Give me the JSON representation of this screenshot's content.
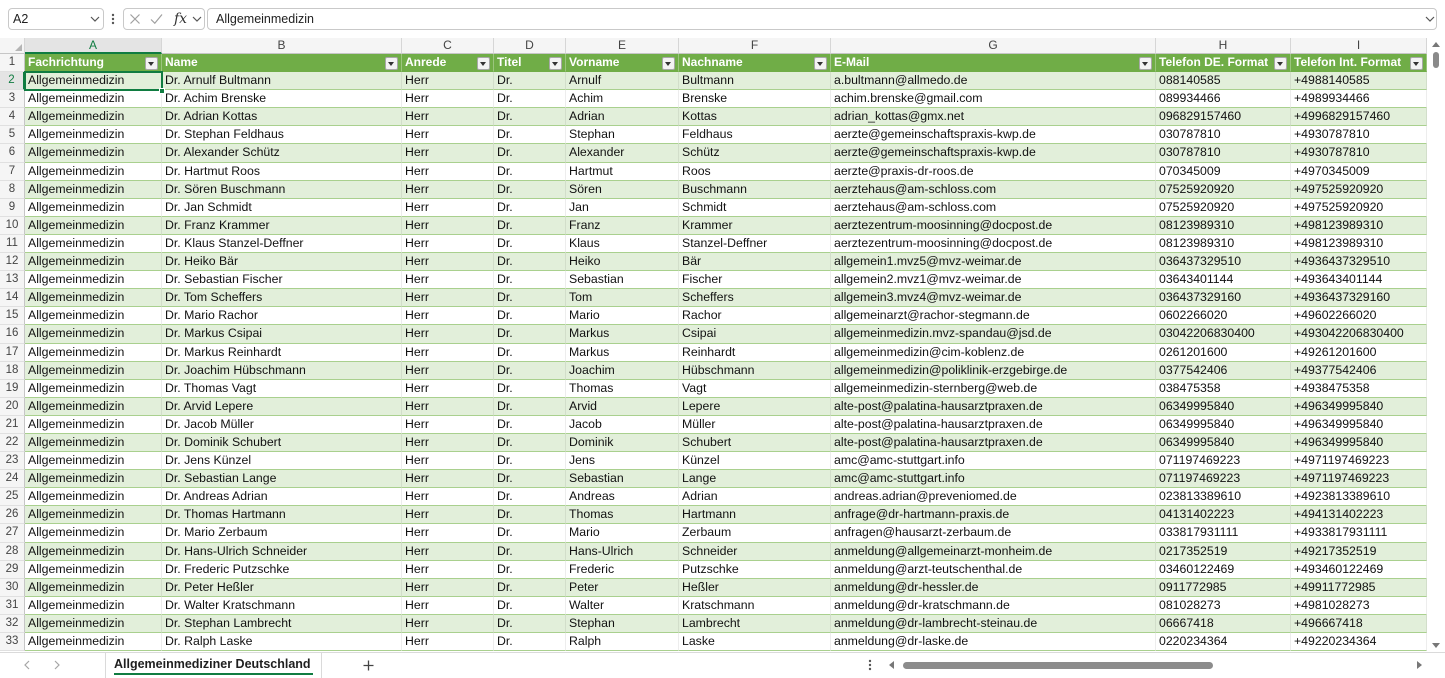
{
  "formula_bar": {
    "name_box": "A2",
    "fx_label": "fx",
    "formula": "Allgemeinmedizin"
  },
  "grid": {
    "column_letters": [
      "A",
      "B",
      "C",
      "D",
      "E",
      "F",
      "G",
      "H",
      "I"
    ],
    "row_numbers": [
      1,
      2,
      3,
      4,
      5,
      6,
      7,
      8,
      9,
      10,
      11,
      12,
      13,
      14,
      15,
      16,
      17,
      18,
      19,
      20,
      21,
      22,
      23,
      24,
      25,
      26,
      27,
      28,
      29,
      30,
      31,
      32,
      33
    ],
    "header": [
      "Fachrichtung",
      "Name",
      "Anrede",
      "Titel",
      "Vorname",
      "Nachname",
      "E-Mail",
      "Telefon DE. Format",
      "Telefon Int. Format"
    ],
    "rows": [
      [
        "Allgemeinmedizin",
        "Dr. Arnulf Bultmann",
        "Herr",
        "Dr.",
        "Arnulf",
        "Bultmann",
        "a.bultmann@allmedo.de",
        "088140585",
        "+4988140585"
      ],
      [
        "Allgemeinmedizin",
        "Dr. Achim Brenske",
        "Herr",
        "Dr.",
        "Achim",
        "Brenske",
        "achim.brenske@gmail.com",
        "089934466",
        "+4989934466"
      ],
      [
        "Allgemeinmedizin",
        "Dr. Adrian Kottas",
        "Herr",
        "Dr.",
        "Adrian",
        "Kottas",
        "adrian_kottas@gmx.net",
        "096829157460",
        "+4996829157460"
      ],
      [
        "Allgemeinmedizin",
        "Dr. Stephan Feldhaus",
        "Herr",
        "Dr.",
        "Stephan",
        "Feldhaus",
        "aerzte@gemeinschaftspraxis-kwp.de",
        "030787810",
        "+4930787810"
      ],
      [
        "Allgemeinmedizin",
        "Dr. Alexander Schütz",
        "Herr",
        "Dr.",
        "Alexander",
        "Schütz",
        "aerzte@gemeinschaftspraxis-kwp.de",
        "030787810",
        "+4930787810"
      ],
      [
        "Allgemeinmedizin",
        "Dr. Hartmut Roos",
        "Herr",
        "Dr.",
        "Hartmut",
        "Roos",
        "aerzte@praxis-dr-roos.de",
        "070345009",
        "+4970345009"
      ],
      [
        "Allgemeinmedizin",
        "Dr. Sören Buschmann",
        "Herr",
        "Dr.",
        "Sören",
        "Buschmann",
        "aerztehaus@am-schloss.com",
        "07525920920",
        "+497525920920"
      ],
      [
        "Allgemeinmedizin",
        "Dr. Jan Schmidt",
        "Herr",
        "Dr.",
        "Jan",
        "Schmidt",
        "aerztehaus@am-schloss.com",
        "07525920920",
        "+497525920920"
      ],
      [
        "Allgemeinmedizin",
        "Dr. Franz Krammer",
        "Herr",
        "Dr.",
        "Franz",
        "Krammer",
        "aerztezentrum-moosinning@docpost.de",
        "08123989310",
        "+498123989310"
      ],
      [
        "Allgemeinmedizin",
        "Dr. Klaus Stanzel-Deffner",
        "Herr",
        "Dr.",
        "Klaus",
        "Stanzel-Deffner",
        "aerztezentrum-moosinning@docpost.de",
        "08123989310",
        "+498123989310"
      ],
      [
        "Allgemeinmedizin",
        "Dr. Heiko Bär",
        "Herr",
        "Dr.",
        "Heiko",
        "Bär",
        "allgemein1.mvz5@mvz-weimar.de",
        "036437329510",
        "+4936437329510"
      ],
      [
        "Allgemeinmedizin",
        "Dr. Sebastian Fischer",
        "Herr",
        "Dr.",
        "Sebastian",
        "Fischer",
        "allgemein2.mvz1@mvz-weimar.de",
        "03643401144",
        "+493643401144"
      ],
      [
        "Allgemeinmedizin",
        "Dr. Tom Scheffers",
        "Herr",
        "Dr.",
        "Tom",
        "Scheffers",
        "allgemein3.mvz4@mvz-weimar.de",
        "036437329160",
        "+4936437329160"
      ],
      [
        "Allgemeinmedizin",
        "Dr. Mario Rachor",
        "Herr",
        "Dr.",
        "Mario",
        "Rachor",
        "allgemeinarzt@rachor-stegmann.de",
        "0602266020",
        "+49602266020"
      ],
      [
        "Allgemeinmedizin",
        "Dr. Markus Csipai",
        "Herr",
        "Dr.",
        "Markus",
        "Csipai",
        "allgemeinmedizin.mvz-spandau@jsd.de",
        "03042206830400",
        "+493042206830400"
      ],
      [
        "Allgemeinmedizin",
        "Dr. Markus Reinhardt",
        "Herr",
        "Dr.",
        "Markus",
        "Reinhardt",
        "allgemeinmedizin@cim-koblenz.de",
        "0261201600",
        "+49261201600"
      ],
      [
        "Allgemeinmedizin",
        "Dr. Joachim Hübschmann",
        "Herr",
        "Dr.",
        "Joachim",
        "Hübschmann",
        "allgemeinmedizin@poliklinik-erzgebirge.de",
        "0377542406",
        "+49377542406"
      ],
      [
        "Allgemeinmedizin",
        "Dr. Thomas Vagt",
        "Herr",
        "Dr.",
        "Thomas",
        "Vagt",
        "allgemeinmedizin-sternberg@web.de",
        "038475358",
        "+4938475358"
      ],
      [
        "Allgemeinmedizin",
        "Dr. Arvid Lepere",
        "Herr",
        "Dr.",
        "Arvid",
        "Lepere",
        "alte-post@palatina-hausarztpraxen.de",
        "06349995840",
        "+496349995840"
      ],
      [
        "Allgemeinmedizin",
        "Dr. Jacob Müller",
        "Herr",
        "Dr.",
        "Jacob",
        "Müller",
        "alte-post@palatina-hausarztpraxen.de",
        "06349995840",
        "+496349995840"
      ],
      [
        "Allgemeinmedizin",
        "Dr. Dominik Schubert",
        "Herr",
        "Dr.",
        "Dominik",
        "Schubert",
        "alte-post@palatina-hausarztpraxen.de",
        "06349995840",
        "+496349995840"
      ],
      [
        "Allgemeinmedizin",
        "Dr. Jens Künzel",
        "Herr",
        "Dr.",
        "Jens",
        "Künzel",
        "amc@amc-stuttgart.info",
        "071197469223",
        "+4971197469223"
      ],
      [
        "Allgemeinmedizin",
        "Dr. Sebastian Lange",
        "Herr",
        "Dr.",
        "Sebastian",
        "Lange",
        "amc@amc-stuttgart.info",
        "071197469223",
        "+4971197469223"
      ],
      [
        "Allgemeinmedizin",
        "Dr. Andreas Adrian",
        "Herr",
        "Dr.",
        "Andreas",
        "Adrian",
        "andreas.adrian@preveniomed.de",
        "023813389610",
        "+4923813389610"
      ],
      [
        "Allgemeinmedizin",
        "Dr. Thomas Hartmann",
        "Herr",
        "Dr.",
        "Thomas",
        "Hartmann",
        "anfrage@dr-hartmann-praxis.de",
        "04131402223",
        "+494131402223"
      ],
      [
        "Allgemeinmedizin",
        "Dr. Mario Zerbaum",
        "Herr",
        "Dr.",
        "Mario",
        "Zerbaum",
        "anfragen@hausarzt-zerbaum.de",
        "033817931111",
        "+4933817931111"
      ],
      [
        "Allgemeinmedizin",
        "Dr. Hans-Ulrich Schneider",
        "Herr",
        "Dr.",
        "Hans-Ulrich",
        "Schneider",
        "anmeldung@allgemeinarzt-monheim.de",
        "0217352519",
        "+49217352519"
      ],
      [
        "Allgemeinmedizin",
        "Dr. Frederic Putzschke",
        "Herr",
        "Dr.",
        "Frederic",
        "Putzschke",
        "anmeldung@arzt-teutschenthal.de",
        "03460122469",
        "+493460122469"
      ],
      [
        "Allgemeinmedizin",
        "Dr. Peter Heßler",
        "Herr",
        "Dr.",
        "Peter",
        "Heßler",
        "anmeldung@dr-hessler.de",
        "0911772985",
        "+49911772985"
      ],
      [
        "Allgemeinmedizin",
        "Dr. Walter Kratschmann",
        "Herr",
        "Dr.",
        "Walter",
        "Kratschmann",
        "anmeldung@dr-kratschmann.de",
        "081028273",
        "+4981028273"
      ],
      [
        "Allgemeinmedizin",
        "Dr. Stephan Lambrecht",
        "Herr",
        "Dr.",
        "Stephan",
        "Lambrecht",
        "anmeldung@dr-lambrecht-steinau.de",
        "06667418",
        "+496667418"
      ],
      [
        "Allgemeinmedizin",
        "Dr. Ralph Laske",
        "Herr",
        "Dr.",
        "Ralph",
        "Laske",
        "anmeldung@dr-laske.de",
        "0220234364",
        "+49220234364"
      ]
    ]
  },
  "sheet_tabs": [
    {
      "label": "Allgemeinmediziner Deutschland",
      "active": true
    }
  ],
  "icons": {
    "name_box_dropdown": "chevron-down-icon",
    "more": "more-options-icon",
    "cancel": "cancel-icon",
    "enter": "enter-icon",
    "expand_formula_bar": "chevron-down-icon",
    "filter": "filter-arrow-icon",
    "previous_sheet": "chevron-left-icon",
    "next_sheet": "chevron-right-icon",
    "add_sheet": "add-sheet-icon"
  },
  "colors": {
    "accent": "#107C41",
    "table_header": "#70AD47",
    "band": "#E2EFDA",
    "row_line": "#A9D08E"
  }
}
